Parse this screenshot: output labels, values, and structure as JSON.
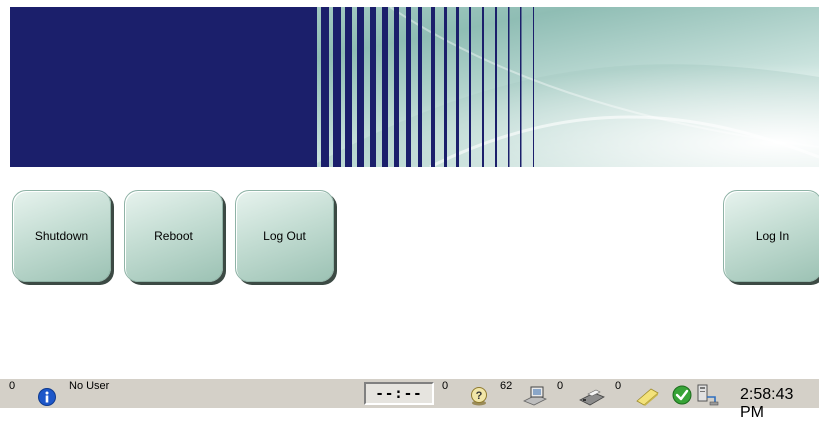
{
  "buttons": {
    "shutdown": "Shutdown",
    "reboot": "Reboot",
    "log_out": "Log Out",
    "log_in": "Log In"
  },
  "status_bar": {
    "info_count": "0",
    "user": "No User",
    "timer": "--:--",
    "help_count": "0",
    "images_count": "62",
    "output_count": "0",
    "notes_count": "0",
    "time": "2:58:43 PM"
  },
  "icons": {
    "info": "info-icon",
    "help": "help-icon",
    "images": "images-icon",
    "output": "print-output-icon",
    "notes": "notes-icon",
    "status": "check-status-icon",
    "network": "network-icon"
  },
  "colors": {
    "banner_blue": "#1b1f6b",
    "button_green": "#c4ddd3",
    "status_gray": "#d4d0c8"
  }
}
